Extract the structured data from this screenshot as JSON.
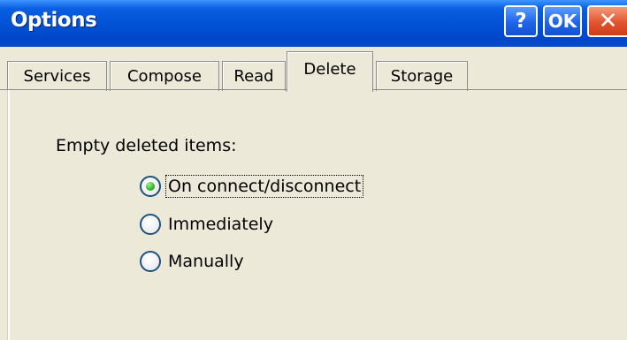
{
  "window": {
    "title": "Options",
    "help_label": "?",
    "ok_label": "OK",
    "close_label": "✕"
  },
  "tabs": [
    {
      "label": "Services"
    },
    {
      "label": "Compose"
    },
    {
      "label": "Read"
    },
    {
      "label": "Delete",
      "active": true
    },
    {
      "label": "Storage"
    }
  ],
  "delete_tab": {
    "group_label": "Empty deleted items:",
    "options": [
      {
        "label": "On connect/disconnect",
        "selected": true
      },
      {
        "label": "Immediately",
        "selected": false
      },
      {
        "label": "Manually",
        "selected": false
      }
    ]
  },
  "colors": {
    "titlebar": "#0352d6",
    "dialog_bg": "#ece9d8",
    "radio_selected": "#31b72a",
    "close_button": "#e2542f"
  }
}
